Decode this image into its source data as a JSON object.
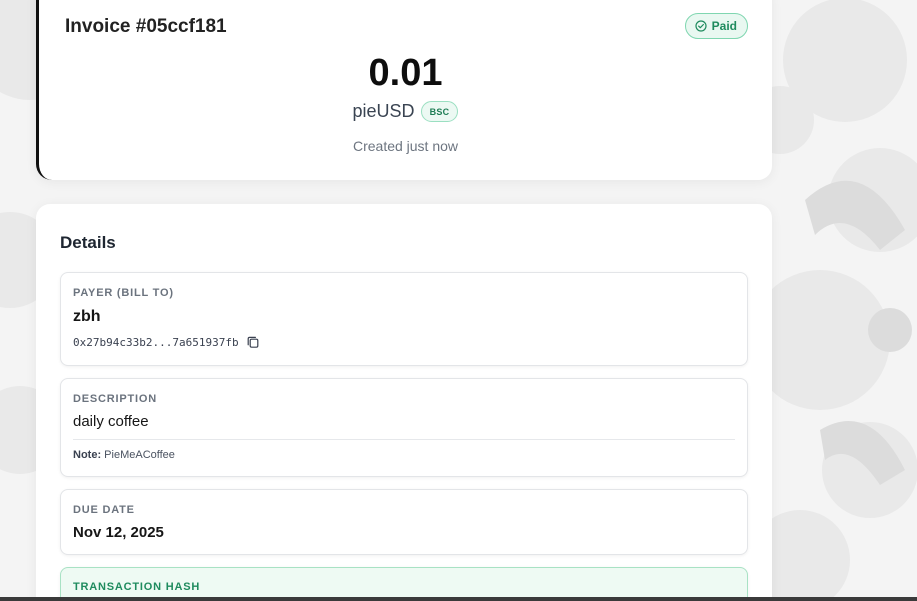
{
  "colors": {
    "accent_green": "#1f8b5e",
    "paid_badge_bg": "#e9f8f1",
    "page_bg": "#f4f4f4",
    "card_bg": "#ffffff",
    "tx_box_bg": "#eefaf3"
  },
  "invoice": {
    "title": "Invoice #05ccf181",
    "status": "Paid",
    "status_icon": "check-circle-icon",
    "amount": "0.01",
    "currency": "pieUSD",
    "chain": "BSC",
    "created": "Created just now"
  },
  "details": {
    "title": "Details",
    "payer": {
      "label": "PAYER (BILL TO)",
      "name": "zbh",
      "address": "0x27b94c33b2...7a651937fb",
      "copy_icon": "copy-icon"
    },
    "description": {
      "label": "DESCRIPTION",
      "value": "daily coffee",
      "note_label": "Note:",
      "note_value": "PieMeACoffee"
    },
    "due_date": {
      "label": "DUE DATE",
      "value": "Nov 12, 2025"
    },
    "transaction": {
      "label": "TRANSACTION HASH"
    }
  }
}
